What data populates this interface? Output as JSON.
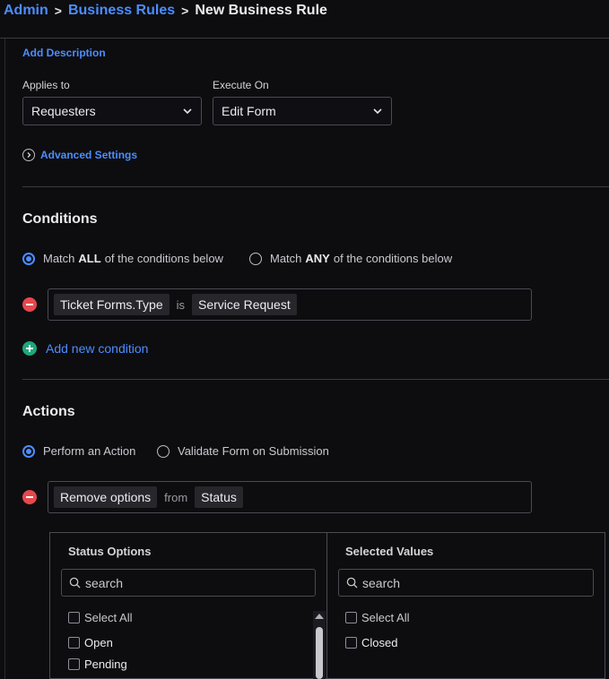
{
  "breadcrumb": {
    "items": [
      "Admin",
      "Business Rules"
    ],
    "current": "New Business Rule"
  },
  "add_description": "Add Description",
  "applies_to": {
    "label": "Applies to",
    "value": "Requesters"
  },
  "execute_on": {
    "label": "Execute On",
    "value": "Edit Form"
  },
  "advanced_settings": "Advanced Settings",
  "conditions": {
    "title": "Conditions",
    "match_all": {
      "prefix": "Match",
      "keyword": "ALL",
      "suffix": "of the conditions below",
      "selected": true
    },
    "match_any": {
      "prefix": "Match",
      "keyword": "ANY",
      "suffix": "of the conditions below",
      "selected": false
    },
    "rule": {
      "field": "Ticket Forms.Type",
      "operator": "is",
      "value": "Service Request"
    },
    "add_label": "Add new condition"
  },
  "actions": {
    "title": "Actions",
    "perform": {
      "label": "Perform an Action",
      "selected": true
    },
    "validate": {
      "label": "Validate Form on Submission",
      "selected": false
    },
    "rule": {
      "action": "Remove options",
      "operator": "from",
      "target": "Status"
    }
  },
  "status_options": {
    "title": "Status Options",
    "search_placeholder": "search",
    "select_all": "Select All",
    "items": [
      "Open",
      "Pending"
    ]
  },
  "selected_values": {
    "title": "Selected Values",
    "search_placeholder": "search",
    "select_all": "Select All",
    "items": [
      "Closed"
    ]
  },
  "colors": {
    "accent": "#4c8dff",
    "danger": "#e5484d",
    "success": "#1fa67a",
    "background": "#0d0d10"
  }
}
